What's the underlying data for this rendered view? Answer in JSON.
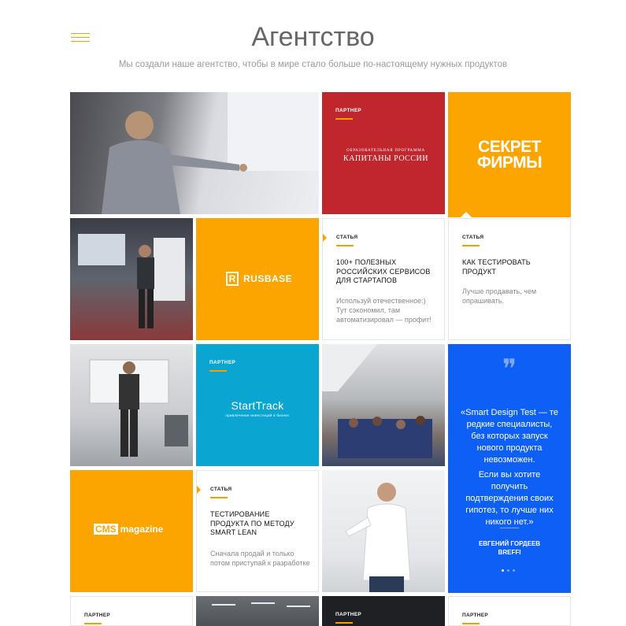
{
  "header": {
    "title": "Агентство",
    "subtitle": "Мы создали наше агентство, чтобы в мире стало больше по-настоящему нужных продуктов"
  },
  "labels": {
    "partner": "ПАРТНЕР",
    "article": "СТАТЬЯ"
  },
  "partners": {
    "kapitany": {
      "small": "ОБРАЗОВАТЕЛЬНАЯ ПРОГРАММА",
      "big": "КАПИТАНЫ РОССИИ"
    },
    "sekret": {
      "line1": "СЕКРЕТ",
      "line2": "ФИРМЫ"
    },
    "rusbase": {
      "mark": "R",
      "name": "RUSBASE"
    },
    "starttrack": {
      "name": "StartTrack",
      "tagline": "привлечение инвестиций в бизнес"
    },
    "cms": {
      "box": "CMS",
      "name": "magazine"
    }
  },
  "articles": [
    {
      "title": "100+ полезных российских сервисов для стартапов",
      "text": "Используй отечественное:) Тут сэкономил, там автоматизировал — профит!"
    },
    {
      "title": "Как тестировать продукт",
      "text": "Лучше продавать, чем опрашивать."
    },
    {
      "title": "Тестирование продукта по методу Smart Lean",
      "text": "Сначала продай и только потом приступай к разработке"
    }
  ],
  "quote": {
    "mark": "❞",
    "text1": "«Smart Design Test — те редкие специалисты, без которых запуск нового продукта невозможен.",
    "text2": "Если вы хотите получить подтверждения своих гипотез, то лучше них никого нет.»",
    "author": "ЕВГЕНИЙ ГОРДЕЕВ",
    "company": "BREFFI"
  },
  "colors": {
    "accent": "#f5a000",
    "red": "#c0272d",
    "orange": "#fca500",
    "cyan": "#0aa6d1",
    "blue": "#0d5ff5"
  }
}
